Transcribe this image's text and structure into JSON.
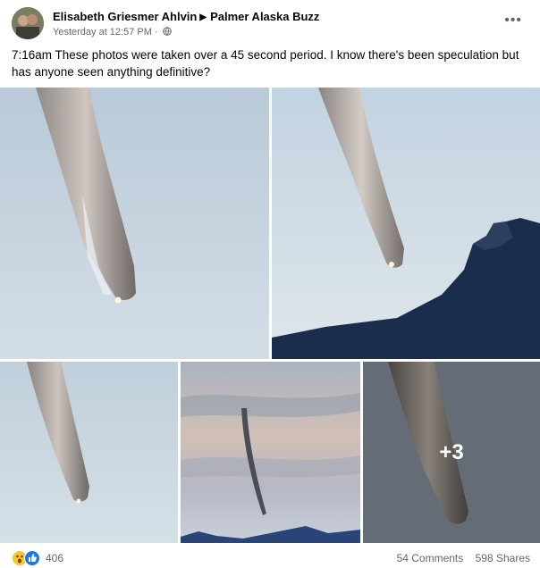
{
  "post": {
    "author": "Elisabeth Griesmer Ahlvin",
    "group": "Palmer Alaska Buzz",
    "timestamp": "Yesterday at 12:57 PM",
    "privacy_icon": "globe-icon",
    "more_icon": "more-options-icon",
    "more_label": "•••",
    "text": "7:16am These photos were taken over a 45 second period. I know there's been speculation but has anyone seen anything definitive?"
  },
  "photos": {
    "overflow_label": "+3"
  },
  "footer": {
    "reaction_icons": [
      "wow-icon",
      "like-icon"
    ],
    "reaction_count": "406",
    "comments": "54 Comments",
    "shares": "598 Shares"
  }
}
